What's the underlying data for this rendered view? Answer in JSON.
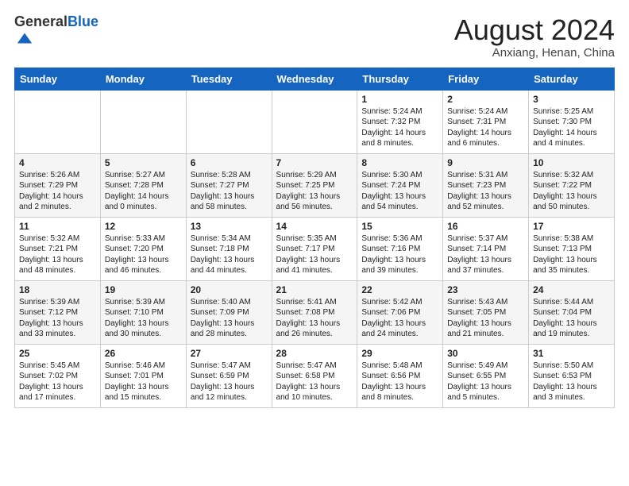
{
  "header": {
    "logo_general": "General",
    "logo_blue": "Blue",
    "month_title": "August 2024",
    "location": "Anxiang, Henan, China"
  },
  "days_of_week": [
    "Sunday",
    "Monday",
    "Tuesday",
    "Wednesday",
    "Thursday",
    "Friday",
    "Saturday"
  ],
  "weeks": [
    [
      {
        "day": "",
        "info": ""
      },
      {
        "day": "",
        "info": ""
      },
      {
        "day": "",
        "info": ""
      },
      {
        "day": "",
        "info": ""
      },
      {
        "day": "1",
        "info": "Sunrise: 5:24 AM\nSunset: 7:32 PM\nDaylight: 14 hours\nand 8 minutes."
      },
      {
        "day": "2",
        "info": "Sunrise: 5:24 AM\nSunset: 7:31 PM\nDaylight: 14 hours\nand 6 minutes."
      },
      {
        "day": "3",
        "info": "Sunrise: 5:25 AM\nSunset: 7:30 PM\nDaylight: 14 hours\nand 4 minutes."
      }
    ],
    [
      {
        "day": "4",
        "info": "Sunrise: 5:26 AM\nSunset: 7:29 PM\nDaylight: 14 hours\nand 2 minutes."
      },
      {
        "day": "5",
        "info": "Sunrise: 5:27 AM\nSunset: 7:28 PM\nDaylight: 14 hours\nand 0 minutes."
      },
      {
        "day": "6",
        "info": "Sunrise: 5:28 AM\nSunset: 7:27 PM\nDaylight: 13 hours\nand 58 minutes."
      },
      {
        "day": "7",
        "info": "Sunrise: 5:29 AM\nSunset: 7:25 PM\nDaylight: 13 hours\nand 56 minutes."
      },
      {
        "day": "8",
        "info": "Sunrise: 5:30 AM\nSunset: 7:24 PM\nDaylight: 13 hours\nand 54 minutes."
      },
      {
        "day": "9",
        "info": "Sunrise: 5:31 AM\nSunset: 7:23 PM\nDaylight: 13 hours\nand 52 minutes."
      },
      {
        "day": "10",
        "info": "Sunrise: 5:32 AM\nSunset: 7:22 PM\nDaylight: 13 hours\nand 50 minutes."
      }
    ],
    [
      {
        "day": "11",
        "info": "Sunrise: 5:32 AM\nSunset: 7:21 PM\nDaylight: 13 hours\nand 48 minutes."
      },
      {
        "day": "12",
        "info": "Sunrise: 5:33 AM\nSunset: 7:20 PM\nDaylight: 13 hours\nand 46 minutes."
      },
      {
        "day": "13",
        "info": "Sunrise: 5:34 AM\nSunset: 7:18 PM\nDaylight: 13 hours\nand 44 minutes."
      },
      {
        "day": "14",
        "info": "Sunrise: 5:35 AM\nSunset: 7:17 PM\nDaylight: 13 hours\nand 41 minutes."
      },
      {
        "day": "15",
        "info": "Sunrise: 5:36 AM\nSunset: 7:16 PM\nDaylight: 13 hours\nand 39 minutes."
      },
      {
        "day": "16",
        "info": "Sunrise: 5:37 AM\nSunset: 7:14 PM\nDaylight: 13 hours\nand 37 minutes."
      },
      {
        "day": "17",
        "info": "Sunrise: 5:38 AM\nSunset: 7:13 PM\nDaylight: 13 hours\nand 35 minutes."
      }
    ],
    [
      {
        "day": "18",
        "info": "Sunrise: 5:39 AM\nSunset: 7:12 PM\nDaylight: 13 hours\nand 33 minutes."
      },
      {
        "day": "19",
        "info": "Sunrise: 5:39 AM\nSunset: 7:10 PM\nDaylight: 13 hours\nand 30 minutes."
      },
      {
        "day": "20",
        "info": "Sunrise: 5:40 AM\nSunset: 7:09 PM\nDaylight: 13 hours\nand 28 minutes."
      },
      {
        "day": "21",
        "info": "Sunrise: 5:41 AM\nSunset: 7:08 PM\nDaylight: 13 hours\nand 26 minutes."
      },
      {
        "day": "22",
        "info": "Sunrise: 5:42 AM\nSunset: 7:06 PM\nDaylight: 13 hours\nand 24 minutes."
      },
      {
        "day": "23",
        "info": "Sunrise: 5:43 AM\nSunset: 7:05 PM\nDaylight: 13 hours\nand 21 minutes."
      },
      {
        "day": "24",
        "info": "Sunrise: 5:44 AM\nSunset: 7:04 PM\nDaylight: 13 hours\nand 19 minutes."
      }
    ],
    [
      {
        "day": "25",
        "info": "Sunrise: 5:45 AM\nSunset: 7:02 PM\nDaylight: 13 hours\nand 17 minutes."
      },
      {
        "day": "26",
        "info": "Sunrise: 5:46 AM\nSunset: 7:01 PM\nDaylight: 13 hours\nand 15 minutes."
      },
      {
        "day": "27",
        "info": "Sunrise: 5:47 AM\nSunset: 6:59 PM\nDaylight: 13 hours\nand 12 minutes."
      },
      {
        "day": "28",
        "info": "Sunrise: 5:47 AM\nSunset: 6:58 PM\nDaylight: 13 hours\nand 10 minutes."
      },
      {
        "day": "29",
        "info": "Sunrise: 5:48 AM\nSunset: 6:56 PM\nDaylight: 13 hours\nand 8 minutes."
      },
      {
        "day": "30",
        "info": "Sunrise: 5:49 AM\nSunset: 6:55 PM\nDaylight: 13 hours\nand 5 minutes."
      },
      {
        "day": "31",
        "info": "Sunrise: 5:50 AM\nSunset: 6:53 PM\nDaylight: 13 hours\nand 3 minutes."
      }
    ]
  ]
}
